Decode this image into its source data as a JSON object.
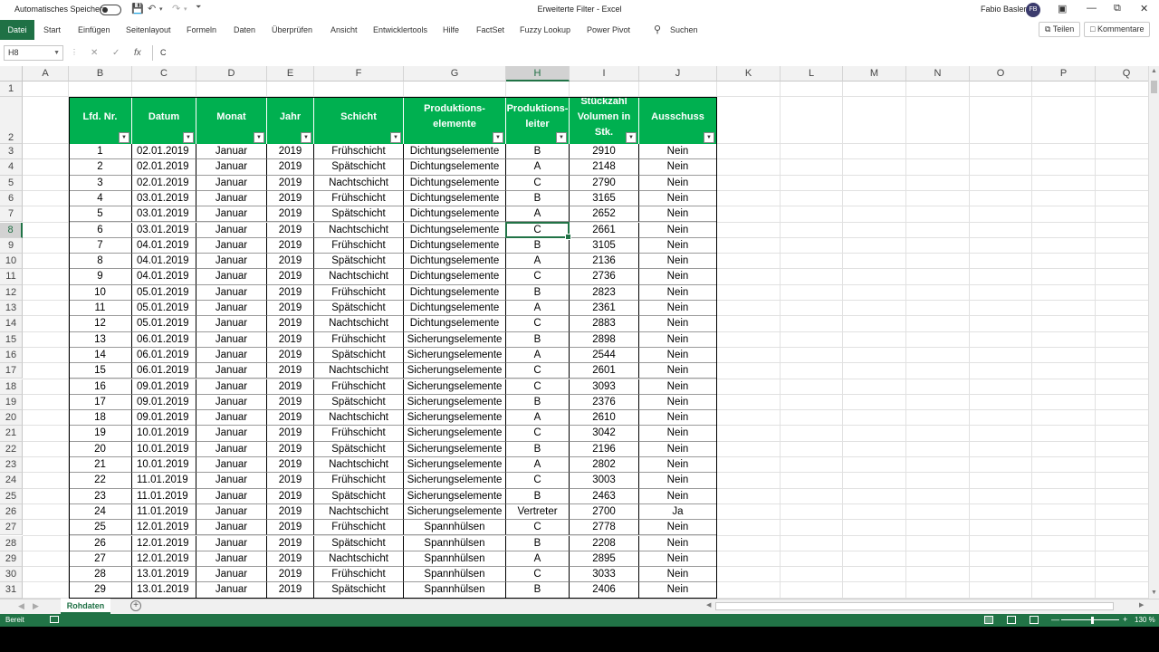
{
  "titlebar": {
    "autosave_label": "Automatisches Speichern",
    "doc_title": "Erweiterte Filter  -  Excel",
    "user_name": "Fabio Basler",
    "user_initials": "FB"
  },
  "menu": {
    "file": "Datei",
    "tabs": [
      "Start",
      "Einfügen",
      "Seitenlayout",
      "Formeln",
      "Daten",
      "Überprüfen",
      "Ansicht",
      "Entwicklertools",
      "Hilfe",
      "FactSet",
      "Fuzzy Lookup",
      "Power Pivot"
    ],
    "search": "Suchen",
    "share": "Teilen",
    "comments": "Kommentare"
  },
  "formula_bar": {
    "name_box": "H8",
    "formula": "C"
  },
  "grid": {
    "columns": [
      "A",
      "B",
      "C",
      "D",
      "E",
      "F",
      "G",
      "H",
      "I",
      "J",
      "K",
      "L",
      "M",
      "N",
      "O",
      "P",
      "Q"
    ],
    "selected_column": "H",
    "selected_row": 8,
    "headers": [
      [
        "Lfd. Nr."
      ],
      [
        "Datum"
      ],
      [
        "Monat"
      ],
      [
        "Jahr"
      ],
      [
        "Schicht"
      ],
      [
        "Produktions-",
        "elemente"
      ],
      [
        "Produktions-",
        "leiter"
      ],
      [
        "Stückzahl",
        "Volumen in",
        "Stk."
      ],
      [
        "Ausschuss"
      ]
    ],
    "rows": [
      [
        "1",
        "02.01.2019",
        "Januar",
        "2019",
        "Frühschicht",
        "Dichtungselemente",
        "B",
        "2910",
        "Nein"
      ],
      [
        "2",
        "02.01.2019",
        "Januar",
        "2019",
        "Spätschicht",
        "Dichtungselemente",
        "A",
        "2148",
        "Nein"
      ],
      [
        "3",
        "02.01.2019",
        "Januar",
        "2019",
        "Nachtschicht",
        "Dichtungselemente",
        "C",
        "2790",
        "Nein"
      ],
      [
        "4",
        "03.01.2019",
        "Januar",
        "2019",
        "Frühschicht",
        "Dichtungselemente",
        "B",
        "3165",
        "Nein"
      ],
      [
        "5",
        "03.01.2019",
        "Januar",
        "2019",
        "Spätschicht",
        "Dichtungselemente",
        "A",
        "2652",
        "Nein"
      ],
      [
        "6",
        "03.01.2019",
        "Januar",
        "2019",
        "Nachtschicht",
        "Dichtungselemente",
        "C",
        "2661",
        "Nein"
      ],
      [
        "7",
        "04.01.2019",
        "Januar",
        "2019",
        "Frühschicht",
        "Dichtungselemente",
        "B",
        "3105",
        "Nein"
      ],
      [
        "8",
        "04.01.2019",
        "Januar",
        "2019",
        "Spätschicht",
        "Dichtungselemente",
        "A",
        "2136",
        "Nein"
      ],
      [
        "9",
        "04.01.2019",
        "Januar",
        "2019",
        "Nachtschicht",
        "Dichtungselemente",
        "C",
        "2736",
        "Nein"
      ],
      [
        "10",
        "05.01.2019",
        "Januar",
        "2019",
        "Frühschicht",
        "Dichtungselemente",
        "B",
        "2823",
        "Nein"
      ],
      [
        "11",
        "05.01.2019",
        "Januar",
        "2019",
        "Spätschicht",
        "Dichtungselemente",
        "A",
        "2361",
        "Nein"
      ],
      [
        "12",
        "05.01.2019",
        "Januar",
        "2019",
        "Nachtschicht",
        "Dichtungselemente",
        "C",
        "2883",
        "Nein"
      ],
      [
        "13",
        "06.01.2019",
        "Januar",
        "2019",
        "Frühschicht",
        "Sicherungselemente",
        "B",
        "2898",
        "Nein"
      ],
      [
        "14",
        "06.01.2019",
        "Januar",
        "2019",
        "Spätschicht",
        "Sicherungselemente",
        "A",
        "2544",
        "Nein"
      ],
      [
        "15",
        "06.01.2019",
        "Januar",
        "2019",
        "Nachtschicht",
        "Sicherungselemente",
        "C",
        "2601",
        "Nein"
      ],
      [
        "16",
        "09.01.2019",
        "Januar",
        "2019",
        "Frühschicht",
        "Sicherungselemente",
        "C",
        "3093",
        "Nein"
      ],
      [
        "17",
        "09.01.2019",
        "Januar",
        "2019",
        "Spätschicht",
        "Sicherungselemente",
        "B",
        "2376",
        "Nein"
      ],
      [
        "18",
        "09.01.2019",
        "Januar",
        "2019",
        "Nachtschicht",
        "Sicherungselemente",
        "A",
        "2610",
        "Nein"
      ],
      [
        "19",
        "10.01.2019",
        "Januar",
        "2019",
        "Frühschicht",
        "Sicherungselemente",
        "C",
        "3042",
        "Nein"
      ],
      [
        "20",
        "10.01.2019",
        "Januar",
        "2019",
        "Spätschicht",
        "Sicherungselemente",
        "B",
        "2196",
        "Nein"
      ],
      [
        "21",
        "10.01.2019",
        "Januar",
        "2019",
        "Nachtschicht",
        "Sicherungselemente",
        "A",
        "2802",
        "Nein"
      ],
      [
        "22",
        "11.01.2019",
        "Januar",
        "2019",
        "Frühschicht",
        "Sicherungselemente",
        "C",
        "3003",
        "Nein"
      ],
      [
        "23",
        "11.01.2019",
        "Januar",
        "2019",
        "Spätschicht",
        "Sicherungselemente",
        "B",
        "2463",
        "Nein"
      ],
      [
        "24",
        "11.01.2019",
        "Januar",
        "2019",
        "Nachtschicht",
        "Sicherungselemente",
        "Vertreter",
        "2700",
        "Ja"
      ],
      [
        "25",
        "12.01.2019",
        "Januar",
        "2019",
        "Frühschicht",
        "Spannhülsen",
        "C",
        "2778",
        "Nein"
      ],
      [
        "26",
        "12.01.2019",
        "Januar",
        "2019",
        "Spätschicht",
        "Spannhülsen",
        "B",
        "2208",
        "Nein"
      ],
      [
        "27",
        "12.01.2019",
        "Januar",
        "2019",
        "Nachtschicht",
        "Spannhülsen",
        "A",
        "2895",
        "Nein"
      ],
      [
        "28",
        "13.01.2019",
        "Januar",
        "2019",
        "Frühschicht",
        "Spannhülsen",
        "C",
        "3033",
        "Nein"
      ],
      [
        "29",
        "13.01.2019",
        "Januar",
        "2019",
        "Spätschicht",
        "Spannhülsen",
        "B",
        "2406",
        "Nein"
      ]
    ]
  },
  "sheet_tab": "Rohdaten",
  "status": {
    "ready": "Bereit",
    "zoom": "130 %"
  },
  "colors": {
    "excel_green": "#217346",
    "header_green": "#00b050"
  }
}
